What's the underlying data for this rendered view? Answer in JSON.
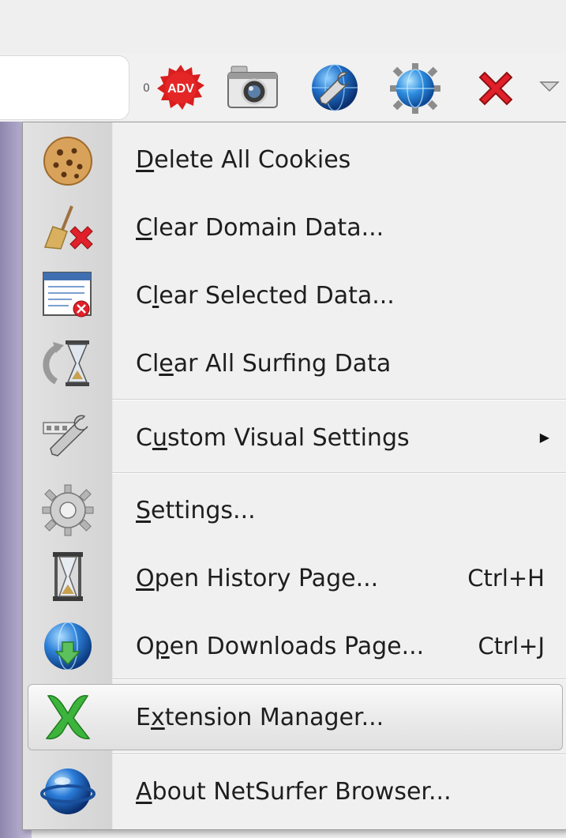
{
  "toolbar": {
    "adblock_count": "0",
    "adblock_badge": "ADV"
  },
  "menu": {
    "items": [
      {
        "pre": "",
        "key": "D",
        "post": "elete All Cookies",
        "shortcut": ""
      },
      {
        "pre": "",
        "key": "C",
        "post": "lear Domain Data...",
        "shortcut": ""
      },
      {
        "pre": "C",
        "key": "l",
        "post": "ear Selected Data...",
        "shortcut": ""
      },
      {
        "pre": "Cl",
        "key": "e",
        "post": "ar All Surfing Data",
        "shortcut": ""
      },
      {
        "pre": "C",
        "key": "u",
        "post": "stom Visual Settings",
        "shortcut": "",
        "submenu": true
      },
      {
        "pre": "",
        "key": "S",
        "post": "ettings...",
        "shortcut": ""
      },
      {
        "pre": "",
        "key": "O",
        "post": "pen History Page...",
        "shortcut": "Ctrl+H"
      },
      {
        "pre": "O",
        "key": "p",
        "post": "en Downloads Page...",
        "shortcut": "Ctrl+J"
      },
      {
        "pre": "E",
        "key": "x",
        "post": "tension Manager...",
        "shortcut": "",
        "highlighted": true
      },
      {
        "pre": "",
        "key": "A",
        "post": "bout NetSurfer Browser...",
        "shortcut": ""
      }
    ]
  },
  "colors": {
    "menu_bg": "#f0f0f0",
    "highlight_border": "#b0b0b0",
    "close_red": "#e0202a",
    "extension_green": "#3cb43c"
  }
}
